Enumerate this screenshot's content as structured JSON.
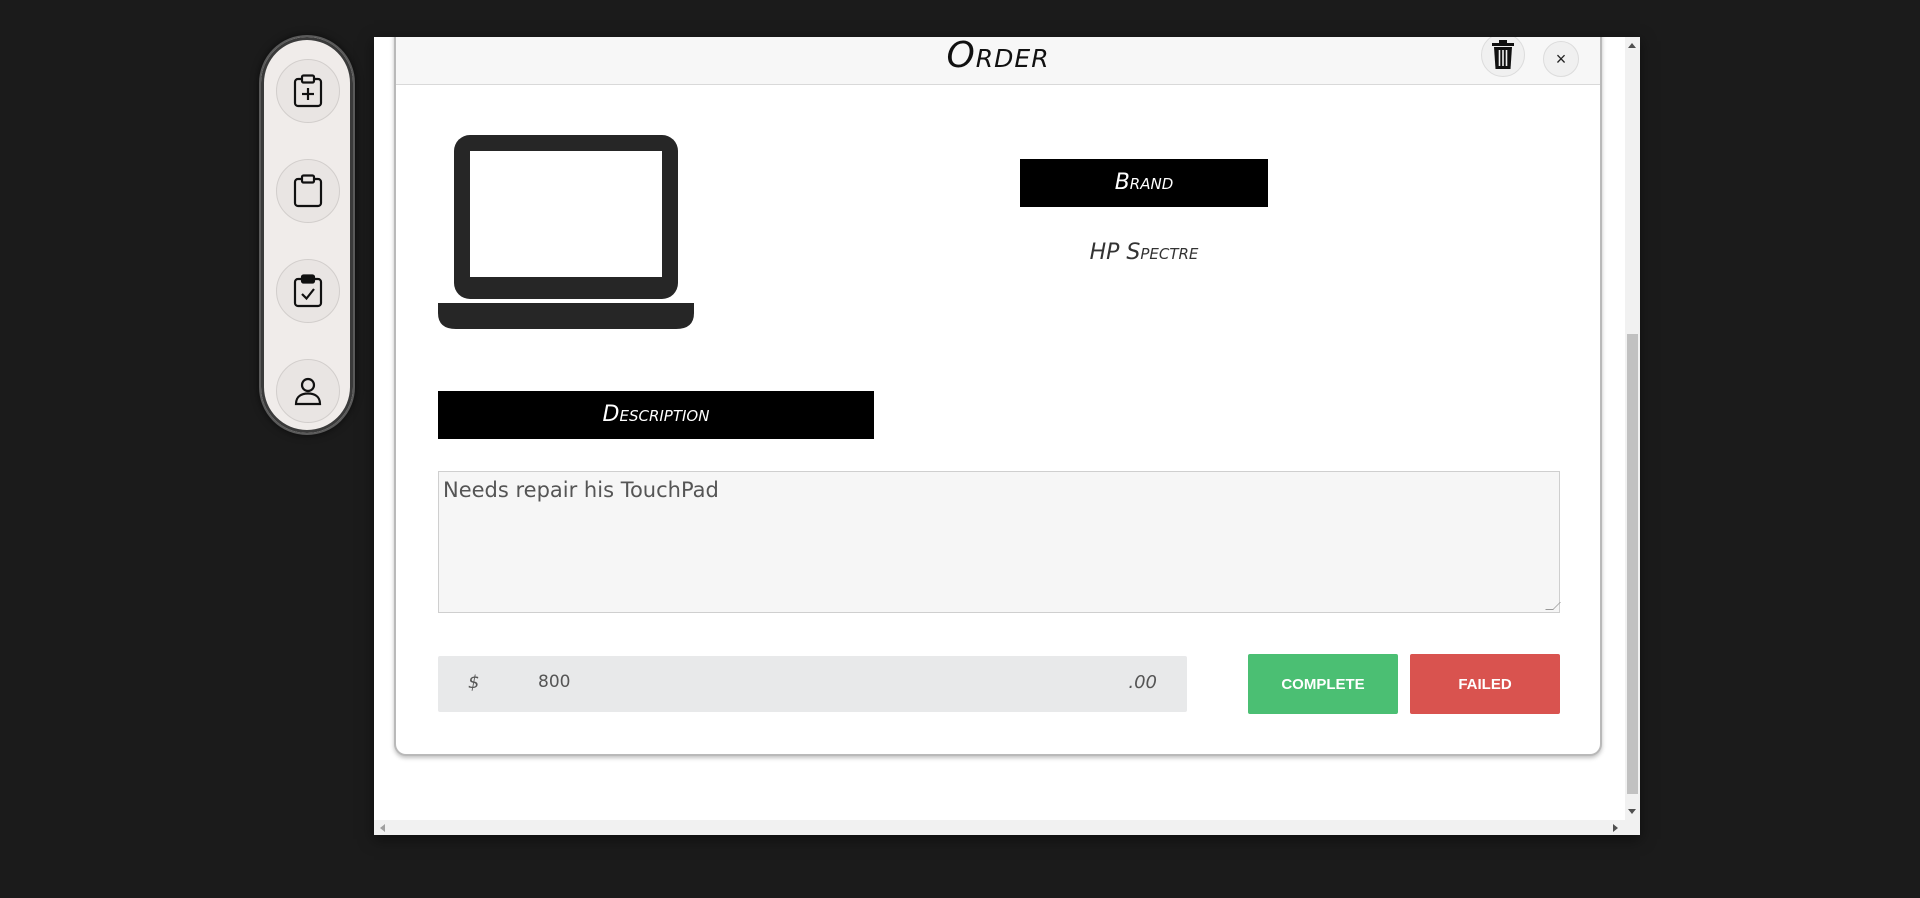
{
  "sidebar": {
    "items": [
      {
        "icon": "clipboard-plus-icon"
      },
      {
        "icon": "clipboard-icon"
      },
      {
        "icon": "clipboard-check-icon"
      },
      {
        "icon": "user-icon"
      }
    ]
  },
  "modal": {
    "title": "Order",
    "trash_icon": "trash-icon",
    "close_label": "×",
    "device_icon": "laptop-icon",
    "brand_label": "Brand",
    "brand_value": "HP Spectre",
    "description_label": "Description",
    "description_value": "Needs repair his TouchPad",
    "price": {
      "currency": "$",
      "value": "800",
      "cents": ".00"
    },
    "complete_label": "COMPLETE",
    "failed_label": "FAILED"
  },
  "colors": {
    "background": "#1b1b1b",
    "complete": "#4bbf73",
    "failed": "#d9534f",
    "label_bar": "#000000"
  }
}
